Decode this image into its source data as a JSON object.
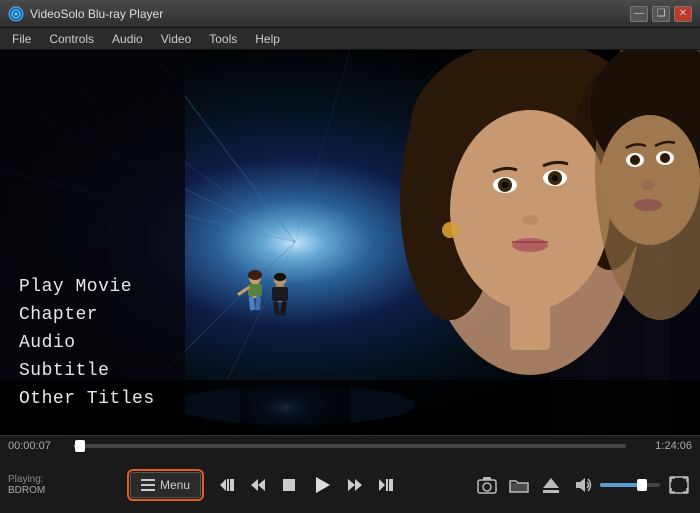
{
  "app": {
    "title": "VideoSolo Blu-ray Player"
  },
  "title_bar": {
    "minimize_label": "—",
    "restore_label": "❑",
    "close_label": "✕"
  },
  "menu_bar": {
    "items": [
      {
        "id": "file",
        "label": "File"
      },
      {
        "id": "controls",
        "label": "Controls"
      },
      {
        "id": "audio",
        "label": "Audio"
      },
      {
        "id": "video",
        "label": "Video"
      },
      {
        "id": "tools",
        "label": "Tools"
      },
      {
        "id": "help",
        "label": "Help"
      }
    ]
  },
  "context_menu": {
    "items": [
      {
        "id": "play-movie",
        "label": "Play Movie"
      },
      {
        "id": "chapter",
        "label": "Chapter"
      },
      {
        "id": "audio",
        "label": "Audio"
      },
      {
        "id": "subtitle",
        "label": "Subtitle"
      },
      {
        "id": "other-titles",
        "label": "Other Titles"
      }
    ]
  },
  "player": {
    "time_current": "00:00:07",
    "time_total": "1:24:06",
    "progress_percent": 1,
    "volume_percent": 70,
    "playing_label": "Playing:",
    "playing_value": "BDROM",
    "menu_button_label": "Menu"
  },
  "transport": {
    "prev_chapter": "⏮",
    "rewind": "⏪",
    "stop": "■",
    "play": "▶",
    "fast_forward": "⏩",
    "next_chapter": "⏭"
  },
  "right_controls": {
    "screenshot": "📷",
    "folder": "📁",
    "eject": "⏏",
    "volume": "🔊",
    "fullscreen": "⛶"
  }
}
